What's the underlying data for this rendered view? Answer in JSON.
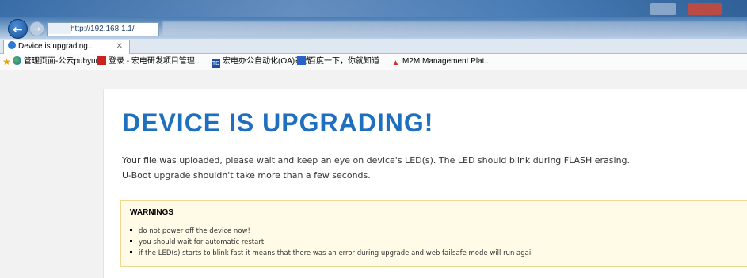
{
  "browser": {
    "url": "http://192.168.1.1/",
    "tab_title": "Device is upgrading...",
    "favorites": [
      {
        "label": "管理页面-公云pubyun",
        "icon": "globe-icon"
      },
      {
        "label": "登录 - 宏电研发项目管理...",
        "icon": "redmine-icon"
      },
      {
        "label": "宏电办公自动化(OA)系统",
        "icon": "td-icon"
      },
      {
        "label": "百度一下，你就知道",
        "icon": "baidu-icon"
      },
      {
        "label": "M2M Management Plat...",
        "icon": "m2m-icon"
      }
    ]
  },
  "page": {
    "title": "DEVICE IS UPGRADING!",
    "line1": "Your file was uploaded, please wait and keep an eye on device's LED(s). The LED should blink during FLASH erasing.",
    "line2": "U-Boot upgrade shouldn't take more than a few seconds.",
    "warnings_title": "WARNINGS",
    "warnings": [
      "do not power off the device now!",
      "you should wait for automatic restart",
      "if the LED(s) starts to blink fast it means that there was an error during upgrade and web failsafe mode will run agai"
    ]
  },
  "colors": {
    "headline": "#1f6fbf",
    "warning_bg": "#fffbe6",
    "warning_border": "#ecd891"
  }
}
